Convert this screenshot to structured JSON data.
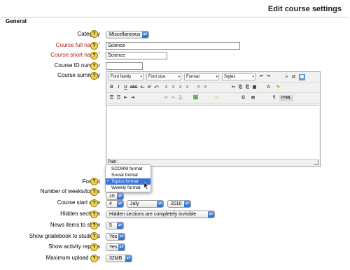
{
  "page": {
    "title": "Edit course settings",
    "section": "General"
  },
  "help_glyph": "?",
  "required_mark": "*",
  "icons": {
    "select_arrow": "▴▾",
    "help": "help-icon",
    "check": "✓"
  },
  "fields": {
    "category": {
      "label": "Category",
      "value": "Miscellaneous"
    },
    "fullname": {
      "label": "Course full name",
      "value": "Science"
    },
    "shortname": {
      "label": "Course short name",
      "value": "Science"
    },
    "idnumber": {
      "label": "Course ID number",
      "value": ""
    },
    "summary": {
      "label": "Course summary"
    },
    "format": {
      "label": "Format"
    },
    "numsections": {
      "label": "Number of weeks/topics",
      "value": "10"
    },
    "startdate": {
      "label": "Course start date",
      "day": "4",
      "month": "July",
      "year": "2010"
    },
    "hiddensections": {
      "label": "Hidden sections",
      "value": "Hidden sections are completely invisible"
    },
    "newsitems": {
      "label": "News items to show",
      "value": "5"
    },
    "showgrades": {
      "label": "Show gradebook to students",
      "value": "Yes"
    },
    "showreports": {
      "label": "Show activity reports",
      "value": "Yes"
    },
    "maxbytes": {
      "label": "Maximum upload size",
      "value": "32MB"
    }
  },
  "editor": {
    "dropdowns": [
      "Font family",
      "Font size",
      "Format",
      "Styles"
    ],
    "row2_buttons": [
      "B",
      "I",
      "U",
      "ABC",
      "x₂",
      "x²",
      "⤺",
      "≡",
      "≡",
      "≡",
      "≡",
      "⟲",
      "⟳",
      "✂",
      "⎘",
      "⎗",
      "▦",
      "A",
      "✎"
    ],
    "row3_buttons": [
      "☰",
      "☷",
      "⇤",
      "⇥",
      "↩",
      "↪",
      "⚓",
      "🖼",
      "☺",
      "Ω",
      "⊞",
      "¶",
      "HTML"
    ],
    "path_label": "Path:"
  },
  "format_options": [
    {
      "label": "SCORM format",
      "selected": false
    },
    {
      "label": "Social format",
      "selected": false
    },
    {
      "label": "Topics format",
      "selected": true
    },
    {
      "label": "Weekly format",
      "selected": false
    }
  ]
}
